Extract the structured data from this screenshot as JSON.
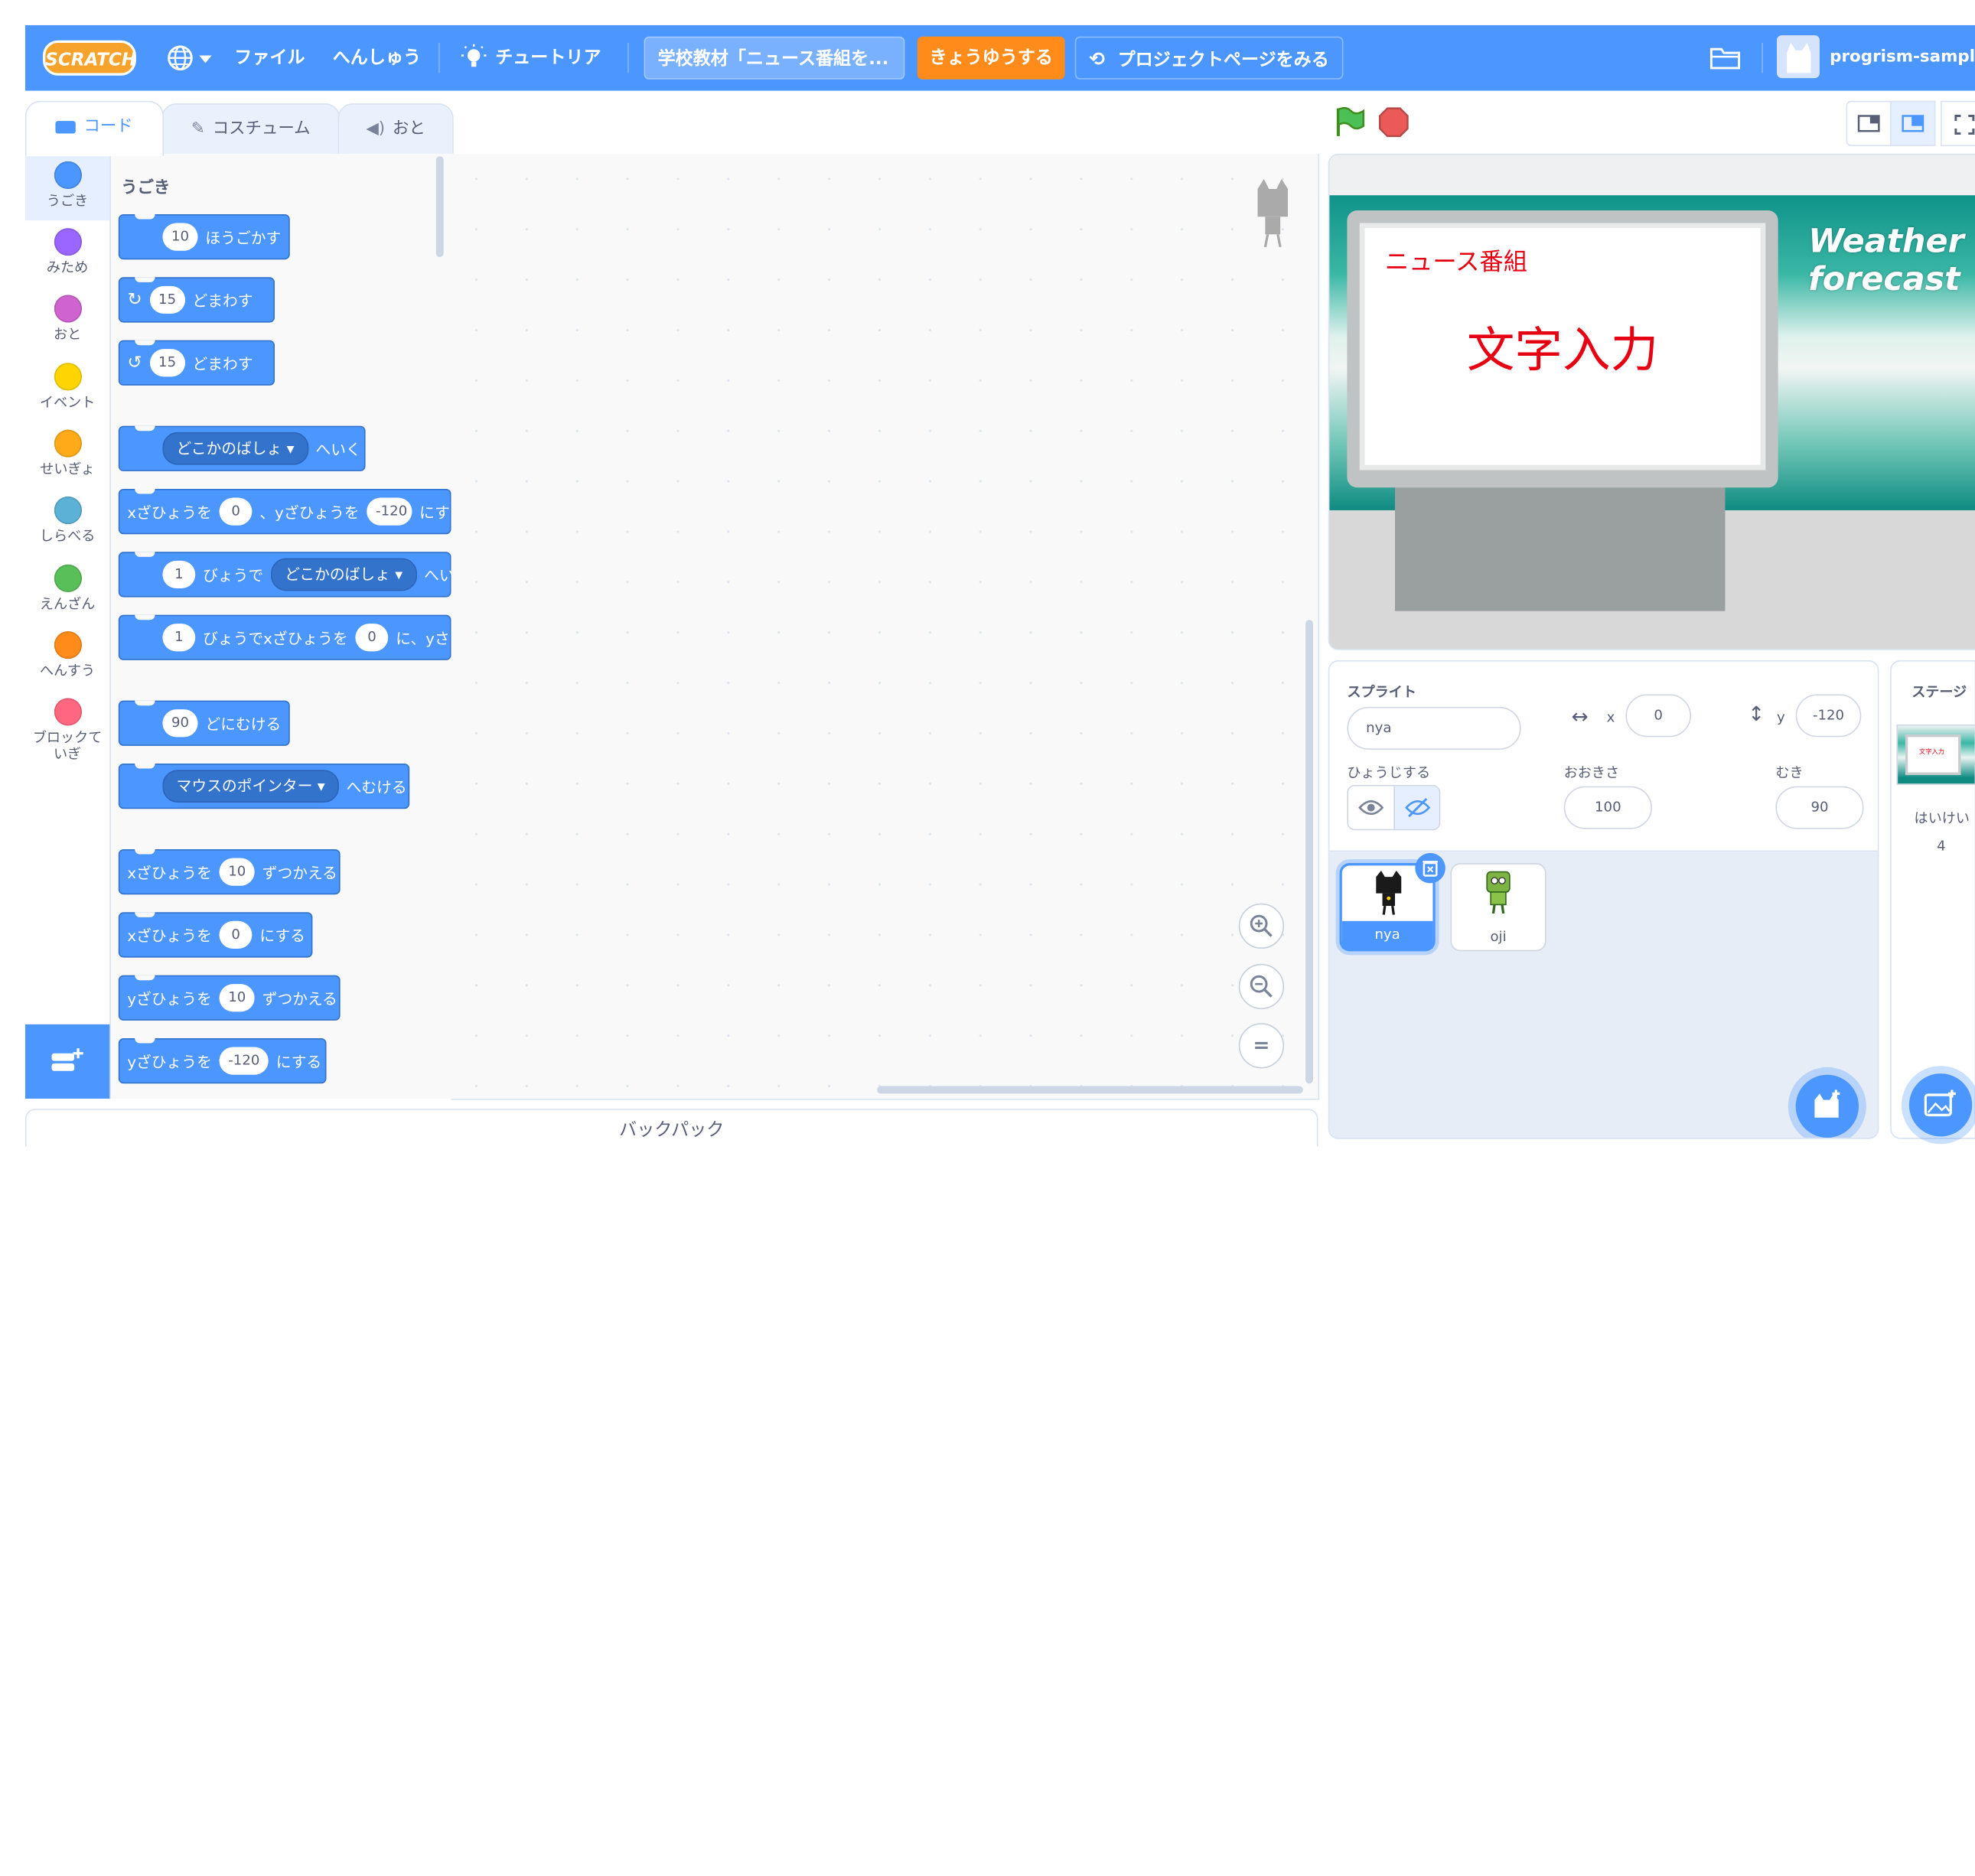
{
  "menubar": {
    "logo": "SCRATCH",
    "file": "ファイル",
    "edit": "へんしゅう",
    "tutorial": "チュートリアル",
    "project_title": "学校教材「ニュース番組を...",
    "share": "きょうゆうする",
    "project_page": "プロジェクトページをみる",
    "username": "progrism-sample"
  },
  "tabs": {
    "code": "コード",
    "costume": "コスチューム",
    "sound": "おと"
  },
  "categories": [
    {
      "label": "うごき",
      "color": "#4c97ff"
    },
    {
      "label": "みため",
      "color": "#9966ff"
    },
    {
      "label": "おと",
      "color": "#cf63cf"
    },
    {
      "label": "イベント",
      "color": "#ffd500"
    },
    {
      "label": "せいぎょ",
      "color": "#ffab19"
    },
    {
      "label": "しらべる",
      "color": "#5cb1d6"
    },
    {
      "label": "えんざん",
      "color": "#59c059"
    },
    {
      "label": "へんすう",
      "color": "#ff8c1a"
    },
    {
      "label": "ブロックて いぎ",
      "color": "#ff6680"
    }
  ],
  "palette": {
    "section_title": "うごき",
    "move_val": "10",
    "move_text": "ほうごかす",
    "turn_right_val": "15",
    "turn_right_text": "どまわす",
    "turn_left_val": "15",
    "turn_left_text": "どまわす",
    "goto_dd": "どこかのばしょ",
    "goto_text": "へいく",
    "gotoxy_x_label": "xざひょうを",
    "gotoxy_x": "0",
    "gotoxy_y_label": "、yざひょうを",
    "gotoxy_y": "-120",
    "gotoxy_tail": "にす",
    "glide_val": "1",
    "glide_text": "びょうで",
    "glide_dd": "どこかのばしょ",
    "glide_tail": "へい",
    "glidexy_val": "1",
    "glidexy_text": "びょうでxざひょうを",
    "glidexy_x": "0",
    "glidexy_tail": "に、yさ",
    "point_val": "90",
    "point_text": "どにむける",
    "towards_dd": "マウスのポインター",
    "towards_text": "へむける",
    "changex_label": "xざひょうを",
    "changex_val": "10",
    "changex_text": "ずつかえる",
    "setx_label": "xざひょうを",
    "setx_val": "0",
    "setx_text": "にする",
    "changey_label": "yざひょうを",
    "changey_val": "10",
    "changey_text": "ずつかえる",
    "sety_label": "yざひょうを",
    "sety_val": "-120",
    "sety_text": "にする"
  },
  "zoom": {
    "reset": "="
  },
  "backpack": "バックパック",
  "stage_view": {
    "news_title": "ニュース番組",
    "news_body": "文字入力",
    "weather": "Weather",
    "forecast": "forecast"
  },
  "sprite_info": {
    "sprite_label": "スプライト",
    "sprite_name": "nya",
    "x_label": "x",
    "x_value": "0",
    "y_label": "y",
    "y_value": "-120",
    "show_label": "ひょうじする",
    "size_label": "おおきさ",
    "size_value": "100",
    "direction_label": "むき",
    "direction_value": "90"
  },
  "sprites": [
    {
      "name": "nya",
      "selected": true
    },
    {
      "name": "oji",
      "selected": false
    }
  ],
  "stage_panel": {
    "title": "ステージ",
    "backdrops_label": "はいけい",
    "backdrops_count": "4",
    "thumb_text": "文字入力"
  }
}
